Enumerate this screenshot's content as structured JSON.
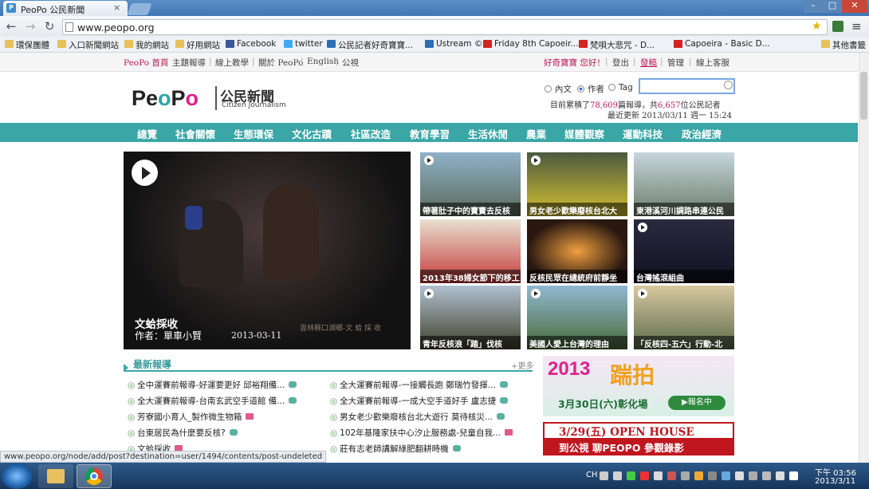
{
  "browser": {
    "tab_title": "PeoPo 公民新聞",
    "tab_favicon": "P",
    "close_glyph": "×",
    "url": "www.peopo.org",
    "window_controls": {
      "minimize": "–",
      "maximize": "□",
      "close": "✕"
    },
    "nav": {
      "back": "←",
      "forward": "→",
      "reload": "↻",
      "star": "★",
      "menu": "≡"
    }
  },
  "bookmarks": [
    {
      "label": "環保團體",
      "icon": "folder"
    },
    {
      "label": "入口新聞網站",
      "icon": "folder"
    },
    {
      "label": "我的網站",
      "icon": "folder"
    },
    {
      "label": "好用網站",
      "icon": "folder"
    },
    {
      "label": "Facebook",
      "icon": "fb"
    },
    {
      "label": "twitter",
      "icon": "tw"
    },
    {
      "label": "公民記者好奇寶寶...",
      "icon": "us"
    },
    {
      "label": "Ustream ©",
      "icon": "us"
    },
    {
      "label": "Friday 8th Capoeir...",
      "icon": "yt"
    },
    {
      "label": "梵唄大悲咒 - D...",
      "icon": "yt"
    },
    {
      "label": "Capoeira - Basic D...",
      "icon": "yt"
    },
    {
      "label": "其他書籤",
      "icon": "folder"
    }
  ],
  "topbar": {
    "left": [
      "PeoPo 首頁",
      "主題報導",
      "線上教學",
      "關於 PeoPo",
      "English",
      "公視"
    ],
    "greeting": "好奇寶寶 您好！",
    "right": [
      "登出",
      "發稿",
      "管理",
      "線上客服"
    ],
    "separator": "|"
  },
  "logo": {
    "wordmark": "PeoPo",
    "title": "公民新聞",
    "subtitle": "Citizen Journalism"
  },
  "search": {
    "options": [
      "內文",
      "作者",
      "Tag"
    ],
    "selected": "作者",
    "value": ""
  },
  "stats": {
    "prefix": "目前累積了",
    "reports": "78,609",
    "mid": "篇報導，共",
    "reporters": "6,657",
    "suffix": "位公民記者",
    "updated": "最近更新 2013/03/11 週一 15:24"
  },
  "nav_items": [
    "總覽",
    "社會關懷",
    "生態環保",
    "文化古蹟",
    "社區改造",
    "教育學習",
    "生活休閒",
    "農業",
    "媒體觀察",
    "運動科技",
    "政治經濟"
  ],
  "hero": {
    "title": "文蛤採收",
    "author": "作者：單車小賢",
    "date": "2013-03-11",
    "watermark": "雲林縣口湖鄉-文 蛤 採 收"
  },
  "thumbs": [
    {
      "caption": "帶著肚子中的寶寶去反核",
      "play": true,
      "bg": "linear-gradient(#8fb0c8,#5a6a5a)"
    },
    {
      "caption": "男女老少歡樂廢核台北大",
      "play": true,
      "bg": "linear-gradient(#4b5a40,#d4c030)"
    },
    {
      "caption": "東港溪河川調路串連公民",
      "play": false,
      "bg": "linear-gradient(#c7d6dc,#6b7c6a)"
    },
    {
      "caption": "2013年38婦女節下的移工",
      "play": false,
      "bg": "linear-gradient(#e8e0d0,#c63a3a)"
    },
    {
      "caption": "反核民眾在總統府前靜坐",
      "play": false,
      "bg": "radial-gradient(#f0a040,#2a1810 70%)"
    },
    {
      "caption": "台灣搖滾組曲",
      "play": true,
      "bg": "linear-gradient(#2a2a40,#101020)"
    },
    {
      "caption": "青年反核浪「踏」伐核",
      "play": true,
      "bg": "linear-gradient(#b0c0d0,#40402a)"
    },
    {
      "caption": "美國人愛上台灣的理由",
      "play": true,
      "bg": "linear-gradient(#90b8d0,#4a6a3a)"
    },
    {
      "caption": "「反核四-五六」行動-北",
      "play": true,
      "bg": "linear-gradient(#d8c8a0,#5a6a4a)"
    }
  ],
  "latest": {
    "heading": "最新報導",
    "more": "+更多",
    "left": [
      {
        "text": "全中運賽前報導-好運要更好 邱裕翔備...",
        "icon": "g"
      },
      {
        "text": "全大運賽前報導-台南玄武空手道館 備...",
        "icon": "g"
      },
      {
        "text": "芳寮國小育人_製作微生物箱",
        "icon": "p"
      },
      {
        "text": "台東居民為什麼要反核?",
        "icon": "g"
      },
      {
        "text": "文蛤採收",
        "icon": "p"
      }
    ],
    "right": [
      {
        "text": "全大運賽前報導-一接觸長跑 鄭瑞竹發揮...",
        "icon": "g"
      },
      {
        "text": "全大運賽前報導-一成大空手道好手 盧志捷",
        "icon": "g"
      },
      {
        "text": "男女老少歡樂廢核台北大遊行 莫待核災...",
        "icon": "g"
      },
      {
        "text": "102年基隆家扶中心汐止服務處-兒童自我...",
        "icon": "p"
      },
      {
        "text": "莊有志老師講解綠肥翻耕時機",
        "icon": "g"
      }
    ],
    "bullet": "◎"
  },
  "ads": {
    "ad1_year": "2013",
    "ad1_big": "踹拍",
    "ad1_date": "3月30日(六)彰化場",
    "ad1_button": "▶報名中",
    "ad2_line1": "3/29(五) OPEN HOUSE",
    "ad2_line2": "到公視 聊PEOPO 參觀錄影"
  },
  "status_url": "www.peopo.org/node/add/post?destination=user/1494/contents/post-undeleted",
  "taskbar": {
    "lang": "CH",
    "time": "下午 03:56",
    "date": "2013/3/11"
  }
}
